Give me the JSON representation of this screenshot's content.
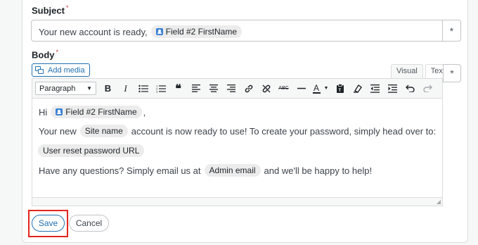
{
  "subject": {
    "label": "Subject",
    "required_mark": "*",
    "prefix_text": "Your new account is ready,",
    "field_tag": "Field #2 FirstName",
    "asterisk": "*"
  },
  "body": {
    "label": "Body",
    "required_mark": "*",
    "add_media_label": "Add media",
    "tabs": [
      {
        "label": "Visual"
      },
      {
        "label": "Text"
      }
    ],
    "asterisk": "*",
    "format_select": "Paragraph",
    "toolbar_icons": [
      "bold-icon",
      "italic-icon",
      "bullet-list-icon",
      "numbered-list-icon",
      "blockquote-icon",
      "align-left-icon",
      "align-center-icon",
      "align-right-icon",
      "link-icon",
      "unlink-icon",
      "strikethrough-icon",
      "horizontal-line-icon",
      "text-color-icon",
      "paste-text-icon",
      "clear-formatting-icon",
      "outdent-icon",
      "indent-icon",
      "undo-icon",
      "redo-icon"
    ],
    "line1_hi": "Hi",
    "line1_tag": "Field #2 FirstName",
    "line1_comma": ",",
    "line2_pre": "Your new",
    "line2_tag": "Site name",
    "line2_post": "account is now ready to use! To create your password, simply head over to:",
    "line3_tag": "User reset password URL",
    "line4_pre": "Have any questions? Simply email us at",
    "line4_tag": "Admin email",
    "line4_post": "and we'll be happy to help!"
  },
  "actions": {
    "save": "Save",
    "cancel": "Cancel"
  },
  "colors": {
    "accent": "#2271b1",
    "highlight": "#e5241b",
    "required": "#d63638"
  }
}
